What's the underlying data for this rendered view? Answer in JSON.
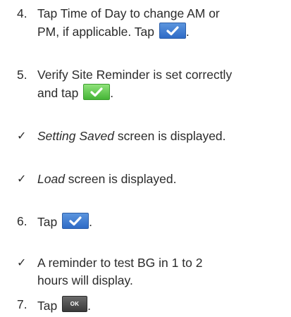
{
  "steps": {
    "s4": {
      "number": "4.",
      "text_pre": "Tap ",
      "emphasis": "Time of Day",
      "text_mid": " to change AM or",
      "line2": "PM, if applicable. Tap",
      "end": "."
    },
    "s5": {
      "number": "5.",
      "line1": "Verify Site Reminder is set correctly",
      "line2": "and tap",
      "end": "."
    },
    "c1": {
      "mark": "✓",
      "emphasis": "Setting Saved",
      "text": " screen is displayed."
    },
    "c2": {
      "mark": "✓",
      "emphasis": "Load",
      "text": " screen is displayed."
    },
    "s6": {
      "number": "6.",
      "text": "Tap",
      "end": "."
    },
    "c3": {
      "mark": "✓",
      "line1": "A reminder to test BG in 1 to 2",
      "line2": "hours will display."
    },
    "s7": {
      "number": "7.",
      "text": "Tap",
      "ok_label": "OK",
      "end": "."
    }
  },
  "icons": {
    "confirm_blue": "check-icon",
    "confirm_green": "check-icon",
    "ok_button": "ok-button"
  },
  "colors": {
    "text": "#2b2b2b",
    "confirm_blue": "#3a78cf",
    "confirm_green": "#5cc64a",
    "ok_button": "#4a4a4a"
  }
}
